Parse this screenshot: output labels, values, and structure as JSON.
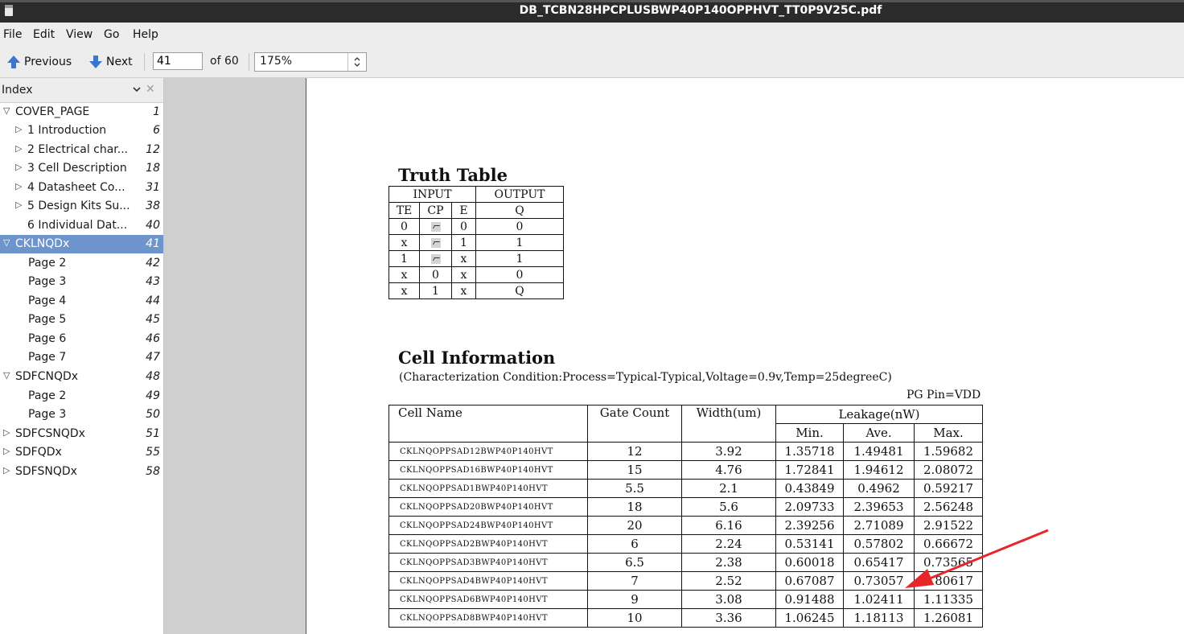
{
  "window": {
    "title": "DB_TCBN28HPCPLUSBWP40P140OPPHVT_TT0P9V25C.pdf"
  },
  "menu": [
    "File",
    "Edit",
    "View",
    "Go",
    "Help"
  ],
  "toolbar": {
    "previous_label": "Previous",
    "next_label": "Next",
    "page_value": "41",
    "of_label": "of 60",
    "zoom_value": "175%"
  },
  "sidebar": {
    "title": "Index",
    "items": [
      {
        "expander": "▽",
        "label": "COVER_PAGE",
        "page": "1"
      },
      {
        "expander": "▷",
        "label": "1 Introduction",
        "page": "6"
      },
      {
        "expander": "▷",
        "label": "2 Electrical char...",
        "page": "12"
      },
      {
        "expander": "▷",
        "label": "3 Cell Description",
        "page": "18"
      },
      {
        "expander": "▷",
        "label": "4 Datasheet Co...",
        "page": "31"
      },
      {
        "expander": "▷",
        "label": "5 Design Kits Su...",
        "page": "38"
      },
      {
        "expander": "",
        "label": "6  Individual Dat...",
        "page": "40"
      },
      {
        "expander": "▽",
        "label": "CKLNQDx",
        "page": "41"
      },
      {
        "expander": "",
        "label": "Page 2",
        "page": "42"
      },
      {
        "expander": "",
        "label": "Page 3",
        "page": "43"
      },
      {
        "expander": "",
        "label": "Page 4",
        "page": "44"
      },
      {
        "expander": "",
        "label": "Page 5",
        "page": "45"
      },
      {
        "expander": "",
        "label": "Page 6",
        "page": "46"
      },
      {
        "expander": "",
        "label": "Page 7",
        "page": "47"
      },
      {
        "expander": "▽",
        "label": "SDFCNQDx",
        "page": "48"
      },
      {
        "expander": "",
        "label": "Page 2",
        "page": "49"
      },
      {
        "expander": "",
        "label": "Page 3",
        "page": "50"
      },
      {
        "expander": "▷",
        "label": "SDFCSNQDx",
        "page": "51"
      },
      {
        "expander": "▷",
        "label": "SDFQDx",
        "page": "55"
      },
      {
        "expander": "▷",
        "label": "SDFSNQDx",
        "page": "58"
      }
    ]
  },
  "document": {
    "truth_table": {
      "title": "Truth Table",
      "group_headers": [
        "INPUT",
        "OUTPUT"
      ],
      "headers": [
        "TE",
        "CP",
        "E",
        "Q"
      ],
      "rows": [
        [
          "0",
          "rise",
          "0",
          "0"
        ],
        [
          "x",
          "rise",
          "1",
          "1"
        ],
        [
          "1",
          "rise",
          "x",
          "1"
        ],
        [
          "x",
          "0",
          "x",
          "0"
        ],
        [
          "x",
          "1",
          "x",
          "Q"
        ]
      ]
    },
    "cell_info": {
      "title": "Cell Information",
      "condition": "(Characterization Condition:Process=Typical-Typical,Voltage=0.9v,Temp=25degreeC)",
      "pg_pin": "PG Pin=VDD",
      "headers": {
        "cell_name": "Cell Name",
        "gate_count": "Gate Count",
        "width": "Width(um)",
        "leakage": "Leakage(nW)",
        "min": "Min.",
        "ave": "Ave.",
        "max": "Max."
      },
      "rows": [
        [
          "CKLNQOPPSAD12BWP40P140HVT",
          "12",
          "3.92",
          "1.35718",
          "1.49481",
          "1.59682"
        ],
        [
          "CKLNQOPPSAD16BWP40P140HVT",
          "15",
          "4.76",
          "1.72841",
          "1.94612",
          "2.08072"
        ],
        [
          "CKLNQOPPSAD1BWP40P140HVT",
          "5.5",
          "2.1",
          "0.43849",
          "0.4962",
          "0.59217"
        ],
        [
          "CKLNQOPPSAD20BWP40P140HVT",
          "18",
          "5.6",
          "2.09733",
          "2.39653",
          "2.56248"
        ],
        [
          "CKLNQOPPSAD24BWP40P140HVT",
          "20",
          "6.16",
          "2.39256",
          "2.71089",
          "2.91522"
        ],
        [
          "CKLNQOPPSAD2BWP40P140HVT",
          "6",
          "2.24",
          "0.53141",
          "0.57802",
          "0.66672"
        ],
        [
          "CKLNQOPPSAD3BWP40P140HVT",
          "6.5",
          "2.38",
          "0.60018",
          "0.65417",
          "0.73565"
        ],
        [
          "CKLNQOPPSAD4BWP40P140HVT",
          "7",
          "2.52",
          "0.67087",
          "0.73057",
          "0.80617"
        ],
        [
          "CKLNQOPPSAD6BWP40P140HVT",
          "9",
          "3.08",
          "0.91488",
          "1.02411",
          "1.11335"
        ],
        [
          "CKLNQOPPSAD8BWP40P140HVT",
          "10",
          "3.36",
          "1.06245",
          "1.18113",
          "1.26081"
        ]
      ]
    }
  },
  "colors": {
    "selection": "#6e95cb",
    "annotation_arrow": "#e8262a",
    "titlebar": "#2b2b2b"
  },
  "icons": {
    "previous": "up-arrow-icon",
    "next": "down-arrow-icon",
    "sidebar_close": "close-icon",
    "sidebar_menu": "chevron-down-icon"
  }
}
